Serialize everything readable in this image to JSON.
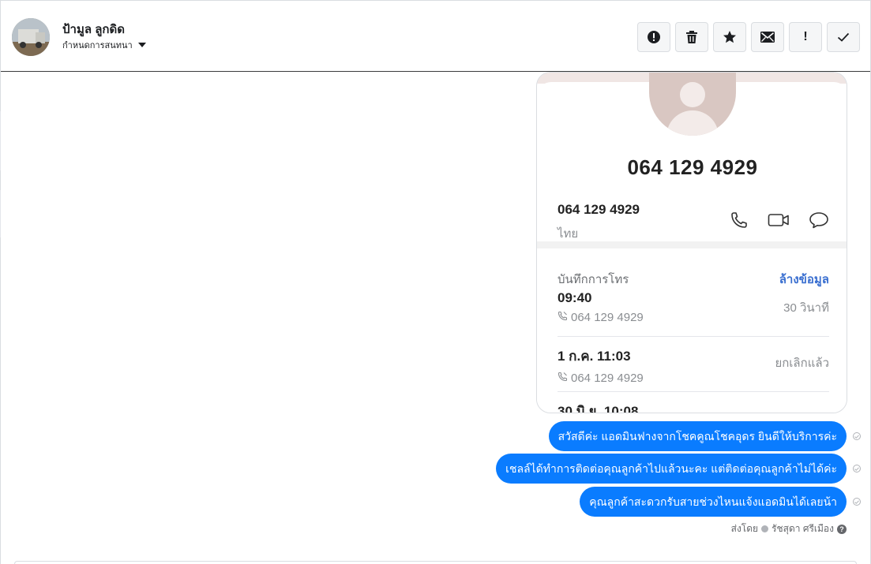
{
  "header": {
    "contact_name": "ป้ามูล ลูกดิด",
    "assign_label": "กำหนดการสนทนา",
    "toolbar": [
      {
        "name": "report-spam-button",
        "icon": "alert-circle-icon"
      },
      {
        "name": "delete-button",
        "icon": "trash-icon"
      },
      {
        "name": "star-button",
        "icon": "star-icon"
      },
      {
        "name": "mark-unread-button",
        "icon": "envelope-icon"
      },
      {
        "name": "mark-follow-up-button",
        "icon": "exclamation-icon",
        "label": "!"
      },
      {
        "name": "mark-done-button",
        "icon": "check-icon"
      }
    ]
  },
  "screenshot_attachment": {
    "big_number": "064 129 4929",
    "number": "064 129 4929",
    "region": "ไทย",
    "log_title": "บันทึกการโทร",
    "log_clear": "ล้างข้อมูล",
    "log": [
      {
        "time": "09:40",
        "number": "064 129 4929",
        "status": "30 วินาที"
      },
      {
        "time": "1 ก.ค. 11:03",
        "number": "064 129 4929",
        "status": "ยกเลิกแล้ว"
      },
      {
        "time": "30 มิ.ย. 10:08",
        "number": "",
        "status": ""
      }
    ]
  },
  "messages": [
    {
      "text": "สวัสดีค่ะ แอดมินฟางจากโชคคูณโชคอุดร ยินดีให้บริการค่ะ"
    },
    {
      "text": "เชลล์ได้ทำการติดต่อคุณลูกค้าไปแล้วนะคะ แต่ติดต่อคุณลูกค้าไม่ได้ค่ะ"
    },
    {
      "text": "คุณลูกค้าสะดวกรับสายช่วงไหนแจ้งแอดมินได้เลยน้า"
    }
  ],
  "sent_by": {
    "prefix": "ส่งโดย",
    "name": "รัชสุดา ศรีเมือง"
  },
  "colors": {
    "bubble": "#0a7cff",
    "link": "#3a6fd0"
  }
}
